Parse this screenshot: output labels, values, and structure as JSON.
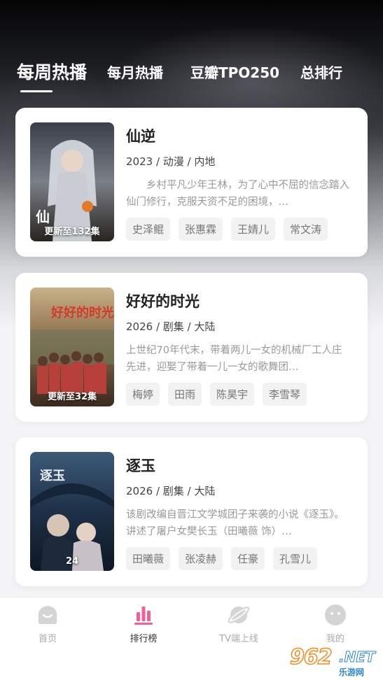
{
  "tabs": [
    {
      "label": "每周热播",
      "active": true
    },
    {
      "label": "每月热播",
      "active": false
    },
    {
      "label": "豆瓣TPO250",
      "active": false
    },
    {
      "label": "总排行",
      "active": false
    }
  ],
  "items": [
    {
      "title": "仙逆",
      "meta": "2023 / 动漫 / 内地",
      "desc": "乡村平凡少年王林，为了心中不屈的信念踏入仙门修行，克服天资不足的困境，…",
      "badge": "更新至132集",
      "poster_text": "仙",
      "tags": [
        "史泽鲲",
        "张惠霖",
        "王婧儿",
        "常文涛"
      ]
    },
    {
      "title": "好好的时光",
      "meta": "2026 / 剧集 / 大陆",
      "desc": "上世纪70年代末，带着两儿一女的机械厂工人庄先进，迎娶了带着一儿一女的歌舞团…",
      "badge": "更新至32集",
      "poster_text": "好好的时光",
      "tags": [
        "梅婷",
        "田雨",
        "陈昊宇",
        "李雪琴"
      ]
    },
    {
      "title": "逐玉",
      "meta": "2026 / 剧集 / 大陆",
      "desc": "该剧改编自晋江文学城团子来袭的小说《逐玉》。讲述了屠户女樊长玉（田曦薇 饰）…",
      "badge": "24",
      "poster_text": "逐玉",
      "tags": [
        "田曦薇",
        "张凌赫",
        "任豪",
        "孔雪儿"
      ]
    }
  ],
  "nav": [
    {
      "label": "首页",
      "icon": "home-icon",
      "active": false
    },
    {
      "label": "排行榜",
      "icon": "ranking-icon",
      "active": true
    },
    {
      "label": "TV端上线",
      "icon": "planet-icon",
      "active": false
    },
    {
      "label": "我的",
      "icon": "profile-icon",
      "active": false
    }
  ],
  "watermark": {
    "big": "962",
    "net": ".NET",
    "sub": "乐游网"
  },
  "colors": {
    "accent": "#f0609a",
    "inactive": "#cfcfcf"
  }
}
